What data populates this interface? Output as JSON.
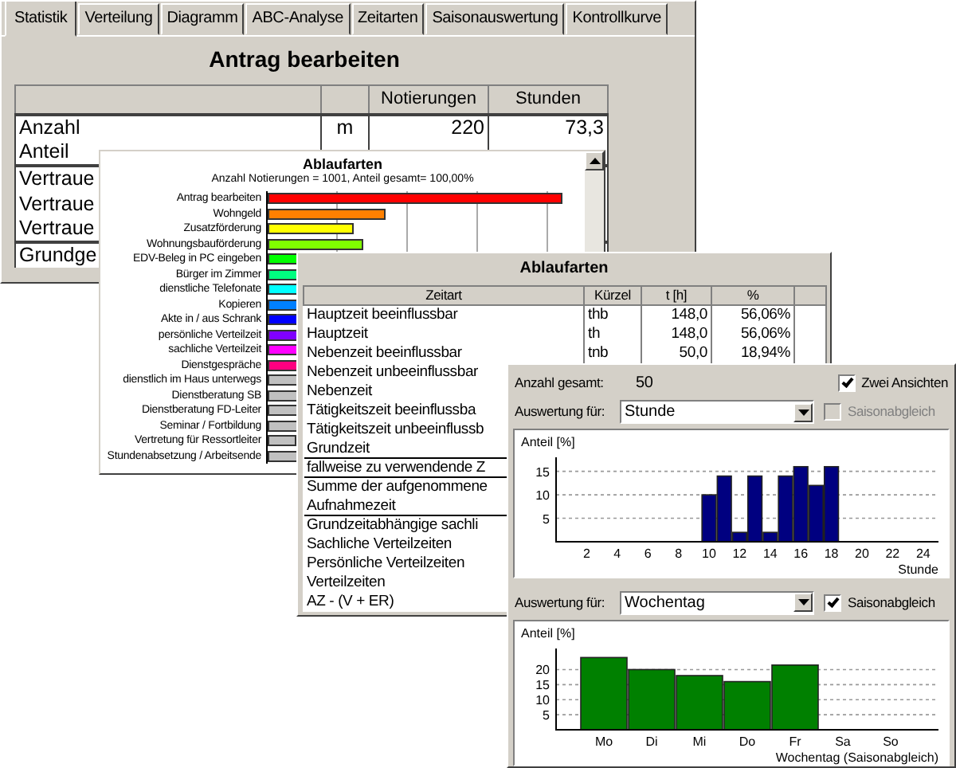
{
  "main_window": {
    "tabs": [
      {
        "label": "Statistik",
        "selected": true
      },
      {
        "label": "Verteilung",
        "selected": false
      },
      {
        "label": "Diagramm",
        "selected": false
      },
      {
        "label": "ABC-Analyse",
        "selected": false
      },
      {
        "label": "Zeitarten",
        "selected": false
      },
      {
        "label": "Saisonauswertung",
        "selected": false
      },
      {
        "label": "Kontrollkurve",
        "selected": false
      }
    ],
    "title": "Antrag bearbeiten",
    "table": {
      "columns": [
        "Notierungen",
        "Stunden"
      ],
      "row_groups": [
        [
          {
            "label": "Anzahl",
            "unit": "m",
            "notierungen": "220",
            "stunden": "73,3"
          },
          {
            "label": "Anteil"
          }
        ],
        [
          {
            "label": "Vertraue"
          },
          {
            "label": "Vertraue"
          },
          {
            "label": "Vertraue"
          }
        ],
        [
          {
            "label": "Grundge"
          }
        ]
      ]
    }
  },
  "chart_window": {
    "title": "Ablaufarten",
    "subtitle": "Anzahl Notierungen = 1001, Anteil gesamt= 100,00%",
    "bars": [
      {
        "label": "Antrag bearbeiten",
        "color": "#ff0000"
      },
      {
        "label": "Wohngeld",
        "color": "#ff8000"
      },
      {
        "label": "Zusatzförderung",
        "color": "#ffff00"
      },
      {
        "label": "Wohnungsbauförderung",
        "color": "#80ff00"
      },
      {
        "label": "EDV-Beleg in PC eingeben",
        "color": "#00ff00"
      },
      {
        "label": "Bürger im Zimmer",
        "color": "#00ff80"
      },
      {
        "label": "dienstliche Telefonate",
        "color": "#00ffff"
      },
      {
        "label": "Kopieren",
        "color": "#0080ff"
      },
      {
        "label": "Akte in / aus Schrank",
        "color": "#0000ff"
      },
      {
        "label": "persönliche Verteilzeit",
        "color": "#8000ff"
      },
      {
        "label": "sachliche Verteilzeit",
        "color": "#ff00ff"
      },
      {
        "label": "Dienstgespräche",
        "color": "#ff0080"
      },
      {
        "label": "dienstlich im Haus unterwegs",
        "color": "#c0c0c0"
      },
      {
        "label": "Dienstberatung SB",
        "color": "#c0c0c0"
      },
      {
        "label": "Dienstberatung FD-Leiter",
        "color": "#c0c0c0"
      },
      {
        "label": "Seminar / Fortbildung",
        "color": "#c0c0c0"
      },
      {
        "label": "Vertretung für Ressortleiter",
        "color": "#c0c0c0"
      },
      {
        "label": "Stundenabsetzung / Arbeitsende",
        "color": "#c0c0c0"
      }
    ]
  },
  "time_types_window": {
    "title": "Ablaufarten",
    "columns": [
      "Zeitart",
      "Kürzel",
      "t [h]",
      "%"
    ],
    "row_groups": [
      [
        {
          "name": "Hauptzeit beeinflussbar",
          "code": "thb",
          "hours": "148,0",
          "percent": "56,06%"
        },
        {
          "name": "Hauptzeit",
          "code": "th",
          "hours": "148,0",
          "percent": "56,06%"
        },
        {
          "name": "Nebenzeit beeinflussbar",
          "code": "tnb",
          "hours": "50,0",
          "percent": "18,94%"
        },
        {
          "name": "Nebenzeit unbeeinflussbar"
        },
        {
          "name": "Nebenzeit"
        },
        {
          "name": "Tätigkeitszeit beeinflussba"
        },
        {
          "name": "Tätigkeitszeit unbeeinflussb"
        },
        {
          "name": "Grundzeit"
        }
      ],
      [
        {
          "name": "fallweise zu verwendende Z"
        }
      ],
      [
        {
          "name": "Summe der aufgenommene"
        },
        {
          "name": "Aufnahmezeit"
        }
      ],
      [
        {
          "name": "Grundzeitabhängige sachli"
        },
        {
          "name": "Sachliche Verteilzeiten"
        },
        {
          "name": "Persönliche Verteilzeiten"
        },
        {
          "name": "Verteilzeiten"
        },
        {
          "name": "AZ - (V + ER)"
        }
      ]
    ]
  },
  "evaluation_window": {
    "total_label": "Anzahl gesamt:",
    "total": "50",
    "two_views": {
      "label": "Zwei Ansichten",
      "checked": true
    },
    "views": [
      {
        "label": "Auswertung für:",
        "value": "Stunde",
        "seasonal": {
          "label": "Saisonabgleich",
          "checked": false,
          "disabled": true
        },
        "chart_data": {
          "type": "bar",
          "ylabel": "Anteil [%]",
          "xlabel": "Stunde",
          "x": [
            10,
            11,
            12,
            13,
            14,
            15,
            16,
            17,
            18
          ],
          "series": [
            {
              "color": "#000080",
              "values": [
                10,
                14,
                2,
                14,
                2,
                14,
                16,
                12,
                16
              ]
            }
          ],
          "grid": true,
          "xlim": [
            0,
            25
          ],
          "ylim": [
            0,
            18
          ],
          "xticks": [
            2,
            4,
            6,
            8,
            10,
            12,
            14,
            16,
            18,
            20,
            22,
            24
          ],
          "yticks": [
            5,
            10,
            15
          ]
        }
      },
      {
        "label": "Auswertung für:",
        "value": "Wochentag",
        "seasonal": {
          "label": "Saisonabgleich",
          "checked": true,
          "disabled": false
        },
        "chart_data": {
          "type": "bar",
          "ylabel": "Anteil [%]",
          "xlabel": "Wochentag (Saisonabgleich)",
          "categories": [
            "Mo",
            "Di",
            "Mi",
            "Do",
            "Fr",
            "Sa",
            "So"
          ],
          "series": [
            {
              "color": "#008000",
              "values": [
                24,
                20,
                18,
                16,
                21.5,
                0,
                0
              ]
            }
          ],
          "grid": true,
          "ylim": [
            0,
            27
          ],
          "yticks": [
            5,
            10,
            15,
            20
          ]
        }
      }
    ]
  }
}
